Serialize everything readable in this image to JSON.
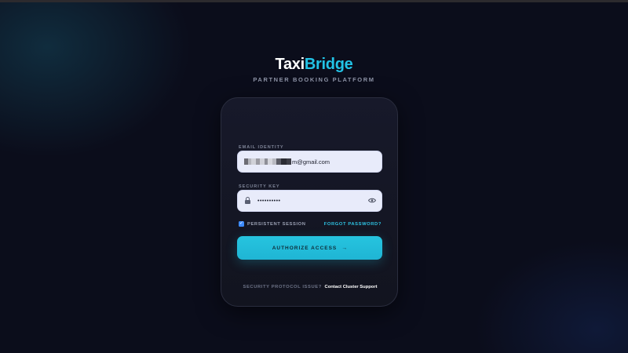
{
  "brand": {
    "logo_part1": "Taxi",
    "logo_part2": "Bridge",
    "tagline": "PARTNER BOOKING PLATFORM",
    "accent_color": "#22c3e6"
  },
  "form": {
    "email_label": "EMAIL IDENTITY",
    "email_value": "m@gmail.com",
    "email_redacted_prefix": true,
    "key_label": "SECURITY KEY",
    "key_value": "••••••••••",
    "lock_icon": "lock-icon",
    "visibility_icon": "eye-icon",
    "persistent_label": "PERSISTENT SESSION",
    "persistent_checked": true,
    "forgot_label": "FORGOT PASSWORD?",
    "submit_label": "AUTHORIZE ACCESS",
    "submit_icon": "→"
  },
  "footer": {
    "prompt": "SECURITY PROTOCOL ISSUE?",
    "link": "Contact Cluster Support"
  }
}
